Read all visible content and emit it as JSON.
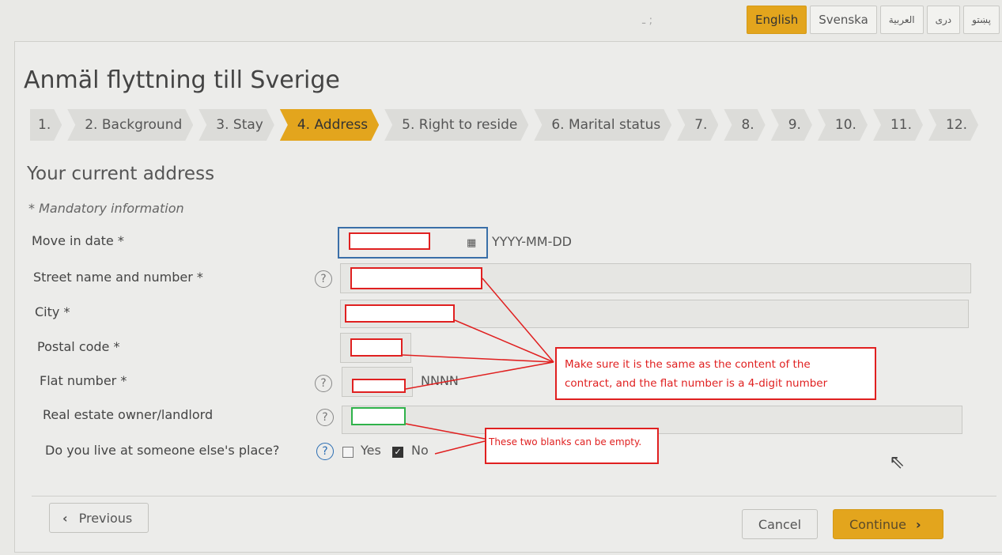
{
  "languages": [
    "English",
    "Svenska",
    "العربية",
    "دری",
    "پښتو"
  ],
  "page_title": "Anmäl flyttning till Sverige",
  "steps": [
    "1.",
    "2. Background",
    "3. Stay",
    "4. Address",
    "5. Right to reside",
    "6. Marital status",
    "7.",
    "8.",
    "9.",
    "10.",
    "11.",
    "12."
  ],
  "section_title": "Your current address",
  "mandatory_note": "* Mandatory information",
  "fields": {
    "move_in_date": {
      "label": "Move in date *",
      "hint": "YYYY-MM-DD"
    },
    "street": {
      "label": "Street name and number *"
    },
    "city": {
      "label": "City *"
    },
    "postal_code": {
      "label": "Postal code *"
    },
    "flat_number": {
      "label": "Flat number *",
      "hint": "NNNN"
    },
    "landlord": {
      "label": "Real estate owner/landlord"
    },
    "someone_else": {
      "label": "Do you live at someone else's place?",
      "yes": "Yes",
      "no": "No",
      "selected": "No"
    }
  },
  "help_glyph": "?",
  "annotations": {
    "note1_line1": "Make sure it is the same as the content of the",
    "note1_line2": "contract, and the flat number is a 4-digit number",
    "note2": "These two blanks can be empty."
  },
  "buttons": {
    "previous": "Previous",
    "cancel": "Cancel",
    "continue": "Continue"
  },
  "colors": {
    "accent": "#e3a51d",
    "annotation": "#e02020",
    "ok_box": "#2fb24a"
  }
}
